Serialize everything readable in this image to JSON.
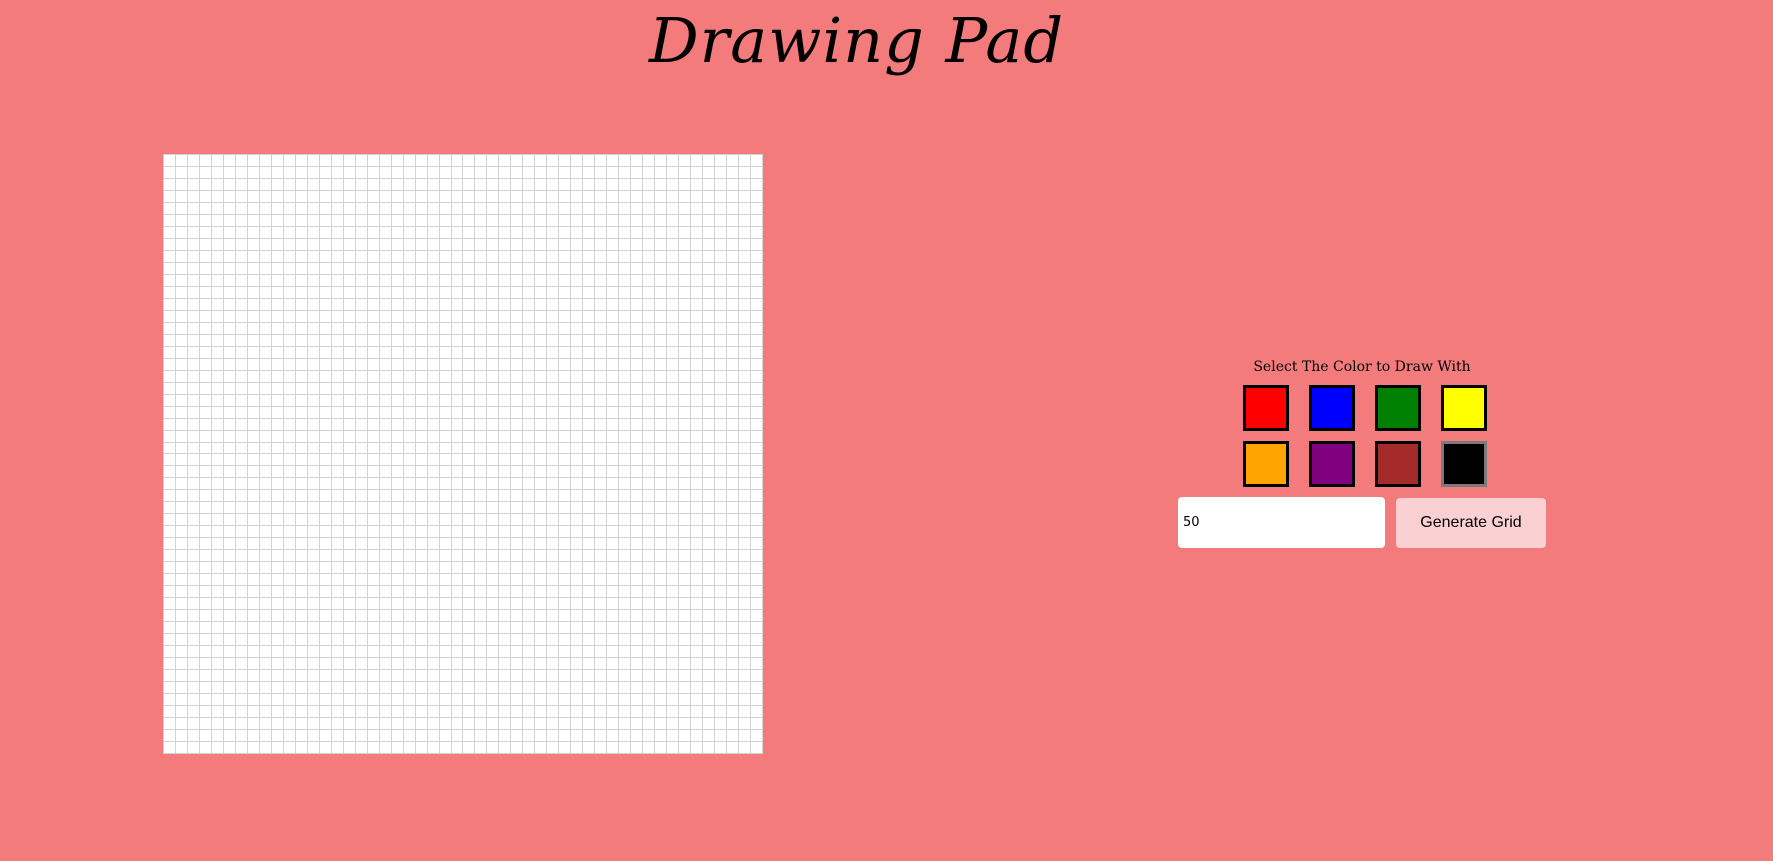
{
  "page": {
    "title": "Drawing Pad",
    "background_color": "#f47b7c"
  },
  "canvas": {
    "grid_size": 50,
    "cell_color": "#ffffff",
    "line_color": "#d3d3d3"
  },
  "palette": {
    "prompt": "Select The Color to Draw With",
    "colors": [
      {
        "name": "red",
        "hex": "#ff0000",
        "selected": false
      },
      {
        "name": "blue",
        "hex": "#0000ff",
        "selected": false
      },
      {
        "name": "green",
        "hex": "#008000",
        "selected": false
      },
      {
        "name": "yellow",
        "hex": "#ffff00",
        "selected": false
      },
      {
        "name": "orange",
        "hex": "#ffa500",
        "selected": false
      },
      {
        "name": "purple",
        "hex": "#800080",
        "selected": false
      },
      {
        "name": "brown",
        "hex": "#a52a2a",
        "selected": false
      },
      {
        "name": "black",
        "hex": "#000000",
        "selected": true
      }
    ]
  },
  "grid_form": {
    "size_value": "50",
    "button_label": "Generate Grid"
  }
}
